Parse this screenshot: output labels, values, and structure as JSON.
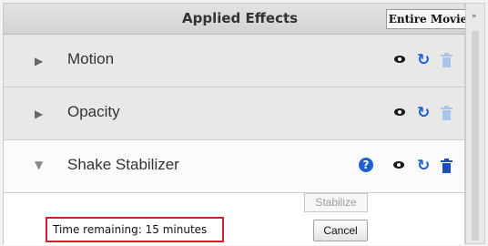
{
  "header": {
    "title": "Applied Effects",
    "scope_button": "Entire Movie",
    "menu_glyph": "»"
  },
  "effects": [
    {
      "name": "Motion",
      "expanded": false,
      "icons": [
        "visibility-eye-icon",
        "reset-icon",
        "trash-icon"
      ]
    },
    {
      "name": "Opacity",
      "expanded": false,
      "icons": [
        "visibility-eye-icon",
        "reset-icon",
        "trash-icon"
      ]
    },
    {
      "name": "Shake Stabilizer",
      "expanded": true,
      "icons": [
        "help-icon",
        "visibility-eye-icon",
        "reset-icon",
        "trash-icon"
      ]
    }
  ],
  "stabilizer": {
    "stabilize_label": "Stabilize",
    "cancel_label": "Cancel",
    "time_remaining": "Time remaining: 15 minutes"
  },
  "glyphs": {
    "collapsed_arrow": "▶",
    "expanded_arrow": "▼",
    "reset": "↻",
    "help": "?"
  },
  "colors": {
    "accent_blue": "#1f5fd1",
    "highlight_red": "#d0202a"
  }
}
